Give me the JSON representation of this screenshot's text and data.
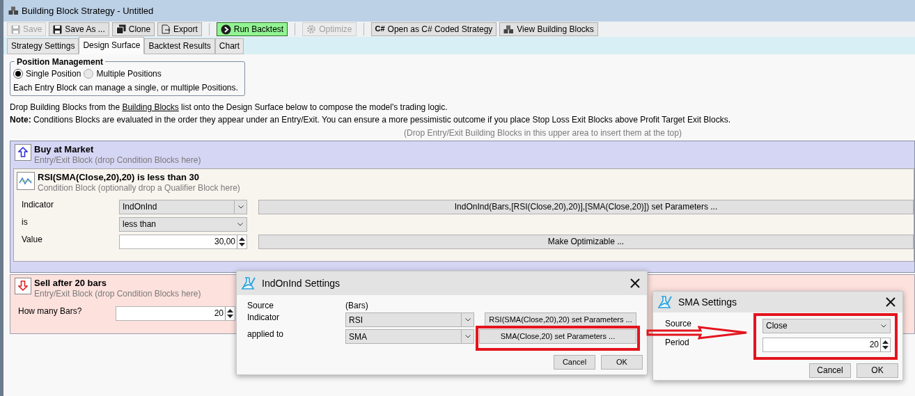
{
  "window": {
    "title": "Building Block Strategy - Untitled"
  },
  "toolbar": [
    {
      "label": "Save",
      "disabled": true,
      "kind": "plain"
    },
    {
      "label": "Save As ...",
      "disabled": false,
      "kind": "plain"
    },
    {
      "label": "Clone",
      "disabled": false,
      "kind": "plain"
    },
    {
      "label": "Export",
      "disabled": false,
      "kind": "plain"
    },
    {
      "label": "Run Backtest",
      "disabled": false,
      "kind": "run"
    },
    {
      "label": "Optimize",
      "disabled": true,
      "kind": "plain"
    },
    {
      "label": "Open as C# Coded Strategy",
      "disabled": false,
      "kind": "plain",
      "badge": "C#"
    },
    {
      "label": "View Building Blocks",
      "disabled": false,
      "kind": "plain"
    }
  ],
  "tabs": [
    {
      "label": "Strategy Settings",
      "selected": false
    },
    {
      "label": "Design Surface",
      "selected": true
    },
    {
      "label": "Backtest Results",
      "selected": false
    },
    {
      "label": "Chart",
      "selected": false
    }
  ],
  "position_management": {
    "title": "Position Management",
    "options": [
      {
        "label": "Single Position",
        "selected": true
      },
      {
        "label": "Multiple Positions",
        "selected": false
      }
    ],
    "note": "Each Entry Block can manage a single, or multiple Positions."
  },
  "intro": {
    "before": "Drop Building Blocks from the",
    "link": "Building Blocks",
    "after": "list onto the Design Surface below to compose the model's trading logic."
  },
  "note": "**Note:** Conditions Blocks are evaluated in the order they appear under an Entry/Exit. You can ensure a more pessimistic outcome if you place Stop Loss Exit Blocks above Profit Target Exit Blocks.",
  "hint": "(Drop Entry/Exit Building Blocks in this upper area to insert them at the top)",
  "blocks": [
    {
      "kind": "entry",
      "title": "Buy at Market",
      "subtitle": "Entry/Exit Block (drop Condition Blocks here)",
      "conditions": [
        {
          "title": "RSI(SMA(Close,20),20) is less than 30",
          "subtitle": "Condition Block (optionally drop a Qualifier Block here)",
          "rows": [
            {
              "label": "Indicator",
              "kind": "combo",
              "value": "IndOnInd",
              "button": "IndOnInd(Bars,[RSI(Close,20),20)],[SMA(Close,20)]) set Parameters ..."
            },
            {
              "label": "is",
              "kind": "select",
              "value": "less than"
            },
            {
              "label": "Value",
              "kind": "spin",
              "value": "30,00",
              "button": "Make Optimizable ..."
            }
          ]
        }
      ]
    },
    {
      "kind": "exit",
      "title": "Sell after 20 bars",
      "subtitle": "Entry/Exit Block (drop Condition Blocks here)",
      "fields": [
        {
          "label": "How many Bars?",
          "value": "20"
        }
      ]
    }
  ],
  "dialogs": [
    {
      "title": "IndOnInd Settings",
      "rows": [
        {
          "label": "Source",
          "kind": "text",
          "value": "(Bars)"
        },
        {
          "label": "Indicator",
          "kind": "combo",
          "value": "RSI",
          "button": "RSI(SMA(Close,20),20) set Parameters ..."
        },
        {
          "label": "applied to",
          "kind": "combo",
          "value": "SMA",
          "button": "SMA(Close,20) set Parameters ..."
        }
      ],
      "buttons": [
        "Cancel",
        "OK"
      ]
    },
    {
      "title": "SMA Settings",
      "rows": [
        {
          "label": "Source",
          "kind": "select",
          "value": "Close"
        },
        {
          "label": "Period",
          "kind": "spin",
          "value": "20"
        }
      ],
      "buttons": [
        "Cancel",
        "OK"
      ]
    }
  ],
  "annotations": [
    {
      "kind": "box"
    },
    {
      "kind": "box"
    },
    {
      "kind": "arrow"
    }
  ]
}
